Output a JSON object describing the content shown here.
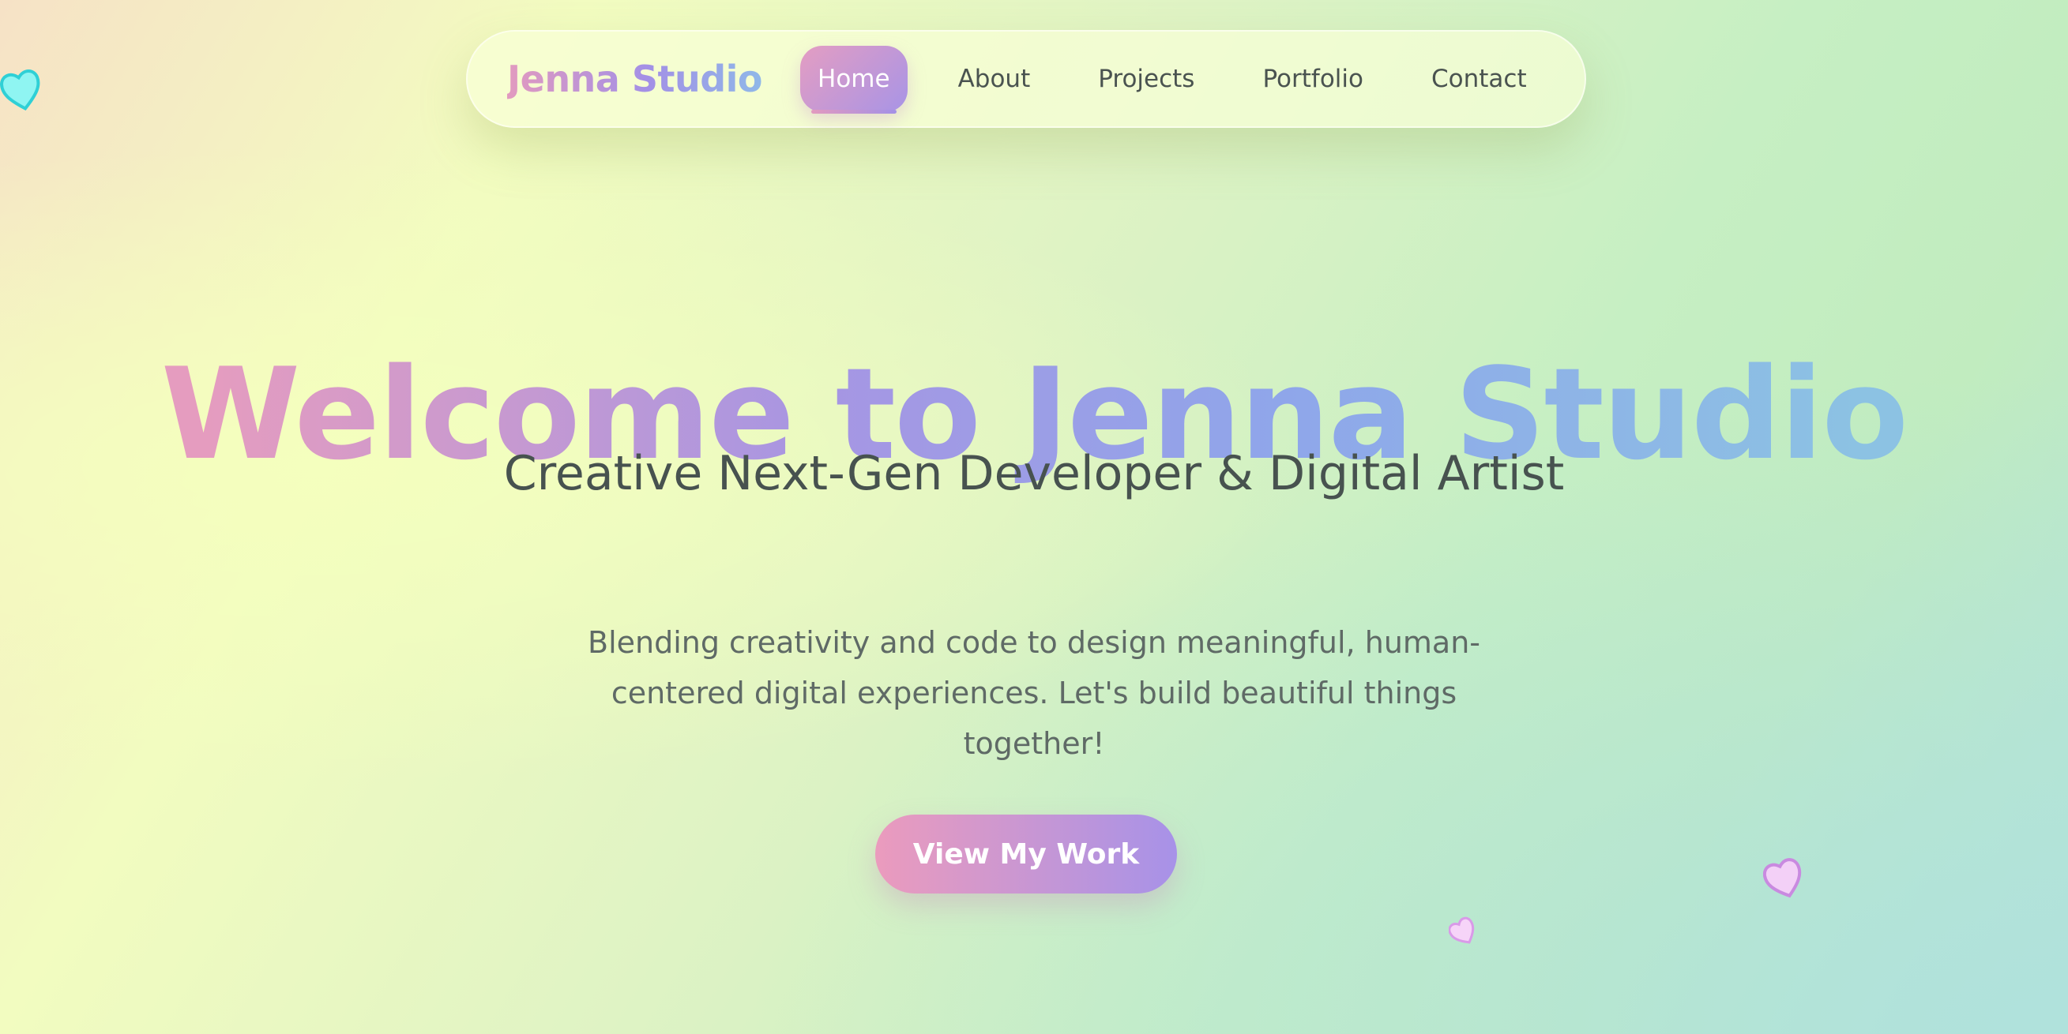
{
  "nav": {
    "brand": "Jenna Studio",
    "links": [
      {
        "label": "Home",
        "active": true
      },
      {
        "label": "About",
        "active": false
      },
      {
        "label": "Projects",
        "active": false
      },
      {
        "label": "Portfolio",
        "active": false
      },
      {
        "label": "Contact",
        "active": false
      }
    ]
  },
  "hero": {
    "title": "Welcome to Jenna Studio",
    "subtitle": "Creative Next-Gen Developer & Digital Artist",
    "description": "Blending creativity and code to design meaningful, human-centered digital experiences. Let's build beautiful things together!",
    "cta_label": "View My Work"
  },
  "decorations": {
    "hearts": [
      {
        "name": "heart-icon",
        "color": "#7ff0ee"
      },
      {
        "name": "heart-icon",
        "color": "#eec4f5"
      },
      {
        "name": "heart-icon",
        "color": "#f2c8f5"
      }
    ]
  },
  "colors": {
    "gradient_start": "#e59cbf",
    "gradient_mid": "#a696e3",
    "gradient_end": "#8cc2e3",
    "text_dark": "#47524f",
    "text_muted": "#5f6a66"
  }
}
